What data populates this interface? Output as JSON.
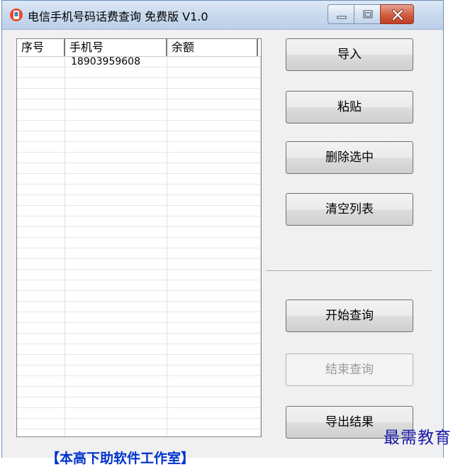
{
  "window": {
    "title": "电信手机号码话费查询 免费版 V1.0",
    "icon": "app-logo-icon",
    "controls": [
      "minimize-icon",
      "maximize-icon",
      "close-icon"
    ],
    "accent_color": "#c23d24"
  },
  "list": {
    "columns": [
      "序号",
      "手机号",
      "余额"
    ],
    "rows": [
      [
        "",
        "18903959608",
        ""
      ]
    ]
  },
  "buttons": {
    "import": "导入",
    "paste": "粘贴",
    "delete_selected": "删除选中",
    "clear_list": "清空列表",
    "start_query": "开始查询",
    "stop_query": "结束查询",
    "export_results": "导出结果"
  },
  "footer": {
    "link_text": "【本高下助软件工作室】"
  },
  "watermark": "最需教育",
  "colors": {
    "link": "#0033cc",
    "watermark": "#1a1aa8"
  }
}
